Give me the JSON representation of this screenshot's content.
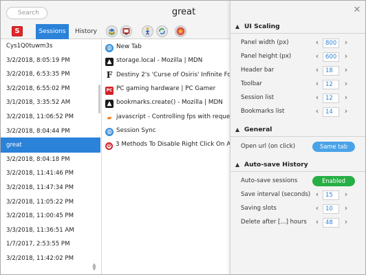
{
  "header": {
    "search_placeholder": "Search",
    "title": "great"
  },
  "tabbar": {
    "logo_letter": "S",
    "tabs": [
      "Sessions",
      "History"
    ],
    "icons": [
      "layers-icon",
      "screen-icon",
      "person-icon",
      "recycle-icon",
      "star-icon"
    ]
  },
  "sessions": [
    "Cys1Q0tuwm3s",
    "3/2/2018, 8:05:19 PM",
    "3/2/2018, 6:53:35 PM",
    "3/2/2018, 6:55:02 PM",
    "3/1/2018, 3:35:52 AM",
    "3/2/2018, 11:06:52 PM",
    "3/2/2018, 8:04:44 PM",
    "great",
    "3/2/2018, 8:04:18 PM",
    "3/2/2018, 11:41:46 PM",
    "3/2/2018, 11:47:34 PM",
    "3/2/2018, 11:05:22 PM",
    "3/2/2018, 11:00:45 PM",
    "3/3/2018, 11:36:51 AM",
    "1/7/2017, 2:53:55 PM",
    "3/2/2018, 11:42:02 PM"
  ],
  "selected_session_index": 7,
  "tabs_list": [
    {
      "title": "New Tab",
      "icon": "globe-icon"
    },
    {
      "title": "storage.local - Mozilla | MDN",
      "icon": "mdn-icon"
    },
    {
      "title": "Destiny 2's 'Curse of Osiris' Infinite Forest",
      "icon": "f-icon"
    },
    {
      "title": "PC gaming hardware | PC Gamer",
      "icon": "pcgamer-icon"
    },
    {
      "title": "bookmarks.create() - Mozilla | MDN",
      "icon": "mdn-icon"
    },
    {
      "title": "javascript - Controlling fps with requestAnimationFrame",
      "icon": "stackoverflow-icon"
    },
    {
      "title": "Session Sync",
      "icon": "globe-icon"
    },
    {
      "title": "3 Methods To Disable Right Click On A Website",
      "icon": "opera-icon"
    }
  ],
  "settings": {
    "ui_scaling": {
      "header": "UI Scaling",
      "rows": [
        {
          "label": "Panel width (px)",
          "value": "800"
        },
        {
          "label": "Panel height (px)",
          "value": "600"
        },
        {
          "label": "Header bar",
          "value": "18"
        },
        {
          "label": "Toolbar",
          "value": "12"
        },
        {
          "label": "Session list",
          "value": "12"
        },
        {
          "label": "Bookmarks list",
          "value": "14"
        }
      ]
    },
    "general": {
      "header": "General",
      "open_url_label": "Open url (on click)",
      "open_url_value": "Same tab"
    },
    "autosave": {
      "header": "Auto-save History",
      "sessions_label": "Auto-save sessions",
      "sessions_value": "Enabled",
      "rows": [
        {
          "label": "Save interval (seconds)",
          "value": "15"
        },
        {
          "label": "Saving slots",
          "value": "10"
        },
        {
          "label": "Delete after [...] hours",
          "value": "48"
        }
      ]
    }
  },
  "colors": {
    "accent": "#2b82d9",
    "enabled": "#27ae45",
    "same_tab": "#4aa3e8"
  }
}
